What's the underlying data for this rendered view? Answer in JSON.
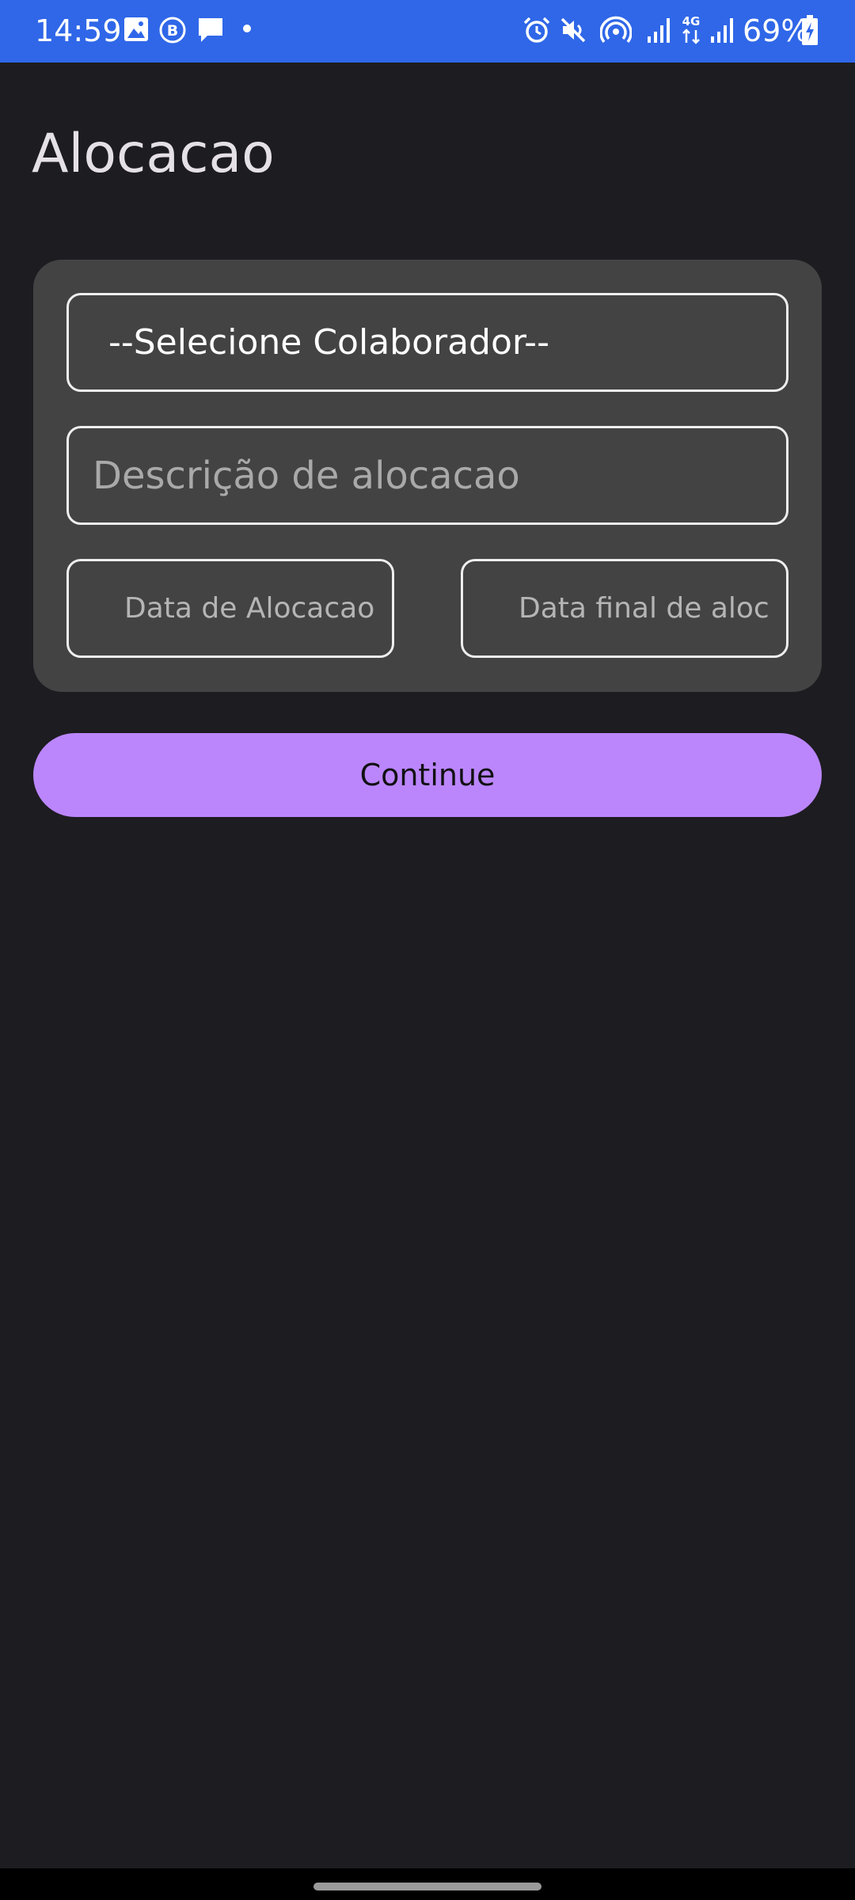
{
  "status_bar": {
    "time": "14:59",
    "battery": "69%",
    "network": "4G",
    "icons": [
      "gallery-icon",
      "b-icon",
      "chat-icon",
      "dot-icon",
      "alarm-icon",
      "mute-icon",
      "hotspot-icon",
      "signal-icon",
      "4g-icon",
      "signal-icon",
      "battery-charging-icon"
    ],
    "background_color": "#2f67e8"
  },
  "page": {
    "title": "Alocacao"
  },
  "form": {
    "collaborator_select": {
      "value": "--Selecione Colaborador--"
    },
    "description": {
      "placeholder": "Descrição de alocacao",
      "value": ""
    },
    "start_date": {
      "placeholder": "Data de Alocacao",
      "value": ""
    },
    "end_date": {
      "placeholder": "Data final de aloc",
      "value": ""
    }
  },
  "actions": {
    "continue_label": "Continue",
    "continue_color": "#bb86fc"
  }
}
